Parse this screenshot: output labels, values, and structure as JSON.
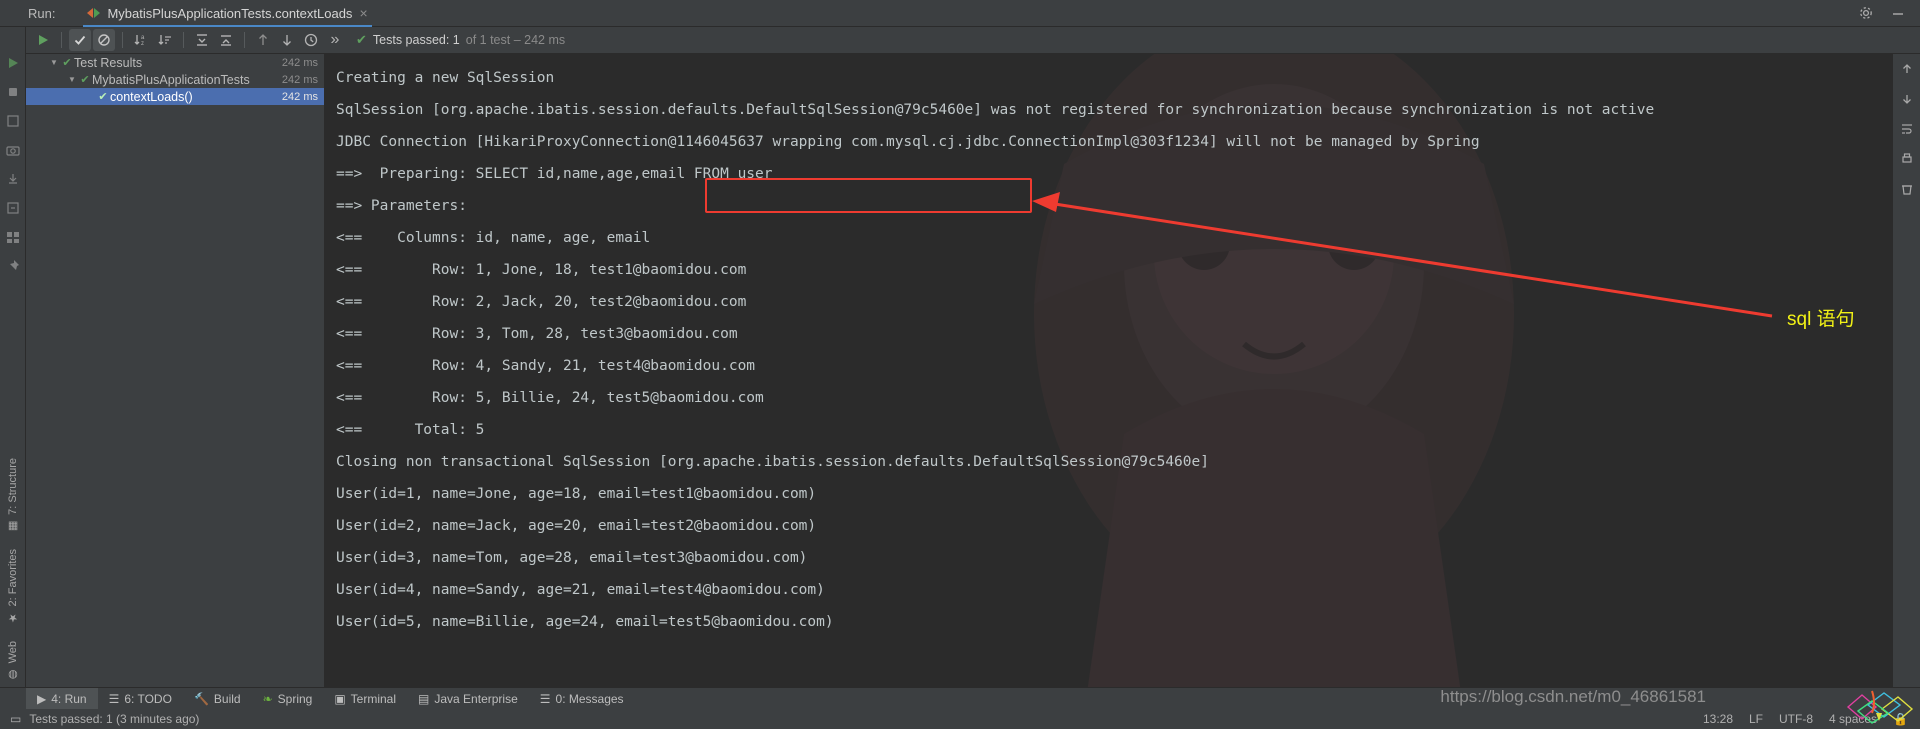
{
  "window": {
    "run_label": "Run:",
    "tab_title": "MybatisPlusApplicationTests.contextLoads",
    "close_glyph": "×"
  },
  "toolbar": {
    "rerun_icon": "run-icon",
    "status_main": "Tests passed: 1",
    "status_sub": "of 1 test – 242 ms",
    "check_glyph": "✔",
    "more_glyph": "»",
    "buttons": [
      {
        "name": "toggle-successful-tests",
        "glyph": "✔"
      },
      {
        "name": "toggle-ignored-tests",
        "glyph": "⊘"
      },
      {
        "name": "sort-alphabetically",
        "glyph": "↓"
      },
      {
        "name": "sort-by-duration",
        "glyph": "↓"
      },
      {
        "name": "expand-all",
        "glyph": "⤓"
      },
      {
        "name": "collapse-all",
        "glyph": "⤒"
      },
      {
        "name": "previous-failed-test",
        "glyph": "↑"
      },
      {
        "name": "next-failed-test",
        "glyph": "↓"
      },
      {
        "name": "test-history",
        "glyph": "◴"
      }
    ]
  },
  "tree": {
    "rows": [
      {
        "label": "Test Results",
        "ms": "242 ms",
        "indent": 0,
        "selected": false,
        "arrow": "▼"
      },
      {
        "label": "MybatisPlusApplicationTests",
        "ms": "242 ms",
        "indent": 1,
        "selected": false,
        "arrow": "▼"
      },
      {
        "label": "contextLoads()",
        "ms": "242 ms",
        "indent": 2,
        "selected": true,
        "arrow": ""
      }
    ]
  },
  "console": {
    "lines": [
      "Creating a new SqlSession",
      "SqlSession [org.apache.ibatis.session.defaults.DefaultSqlSession@79c5460e] was not registered for synchronization because synchronization is not active",
      "JDBC Connection [HikariProxyConnection@1146045637 wrapping com.mysql.cj.jdbc.ConnectionImpl@303f1234] will not be managed by Spring",
      "==>  Preparing: SELECT id,name,age,email FROM user",
      "==> Parameters:",
      "<==    Columns: id, name, age, email",
      "<==        Row: 1, Jone, 18, test1@baomidou.com",
      "<==        Row: 2, Jack, 20, test2@baomidou.com",
      "<==        Row: 3, Tom, 28, test3@baomidou.com",
      "<==        Row: 4, Sandy, 21, test4@baomidou.com",
      "<==        Row: 5, Billie, 24, test5@baomidou.com",
      "<==      Total: 5",
      "Closing non transactional SqlSession [org.apache.ibatis.session.defaults.DefaultSqlSession@79c5460e]",
      "User(id=1, name=Jone, age=18, email=test1@baomidou.com)",
      "User(id=2, name=Jack, age=20, email=test2@baomidou.com)",
      "User(id=3, name=Tom, age=28, email=test3@baomidou.com)",
      "User(id=4, name=Sandy, age=21, email=test4@baomidou.com)",
      "User(id=5, name=Billie, age=24, email=test5@baomidou.com)"
    ],
    "annotation": "sql 语句",
    "highlight_color": "#ee3b30",
    "annotation_color": "#f2f216"
  },
  "left_tabs": [
    {
      "label": "7: Structure",
      "icon": "structure-icon"
    },
    {
      "label": "2: Favorites",
      "icon": "star-icon"
    },
    {
      "label": "Web",
      "icon": "globe-icon"
    }
  ],
  "bottom_tabs": [
    {
      "label": "4: Run",
      "num": "4",
      "rest": ": Run",
      "icon": "run-icon",
      "active": true
    },
    {
      "label": "6: TODO",
      "num": "6",
      "rest": ": TODO",
      "icon": "todo-icon",
      "active": false
    },
    {
      "label": "Build",
      "num": "",
      "rest": "Build",
      "icon": "build-icon",
      "active": false
    },
    {
      "label": "Spring",
      "num": "",
      "rest": "Spring",
      "icon": "spring-icon",
      "active": false
    },
    {
      "label": "Terminal",
      "num": "",
      "rest": "Terminal",
      "icon": "terminal-icon",
      "active": false
    },
    {
      "label": "Java Enterprise",
      "num": "",
      "rest": "Java Enterprise",
      "icon": "java-enterprise-icon",
      "active": false
    },
    {
      "label": "0: Messages",
      "num": "0",
      "rest": ": Messages",
      "icon": "messages-icon",
      "active": false
    }
  ],
  "statusbar": {
    "message": "Tests passed: 1 (3 minutes ago)",
    "time": "13:28",
    "line_separator": "LF",
    "encoding": "UTF-8",
    "indent": "4 spaces"
  },
  "watermark": "https://blog.csdn.net/m0_46861581"
}
